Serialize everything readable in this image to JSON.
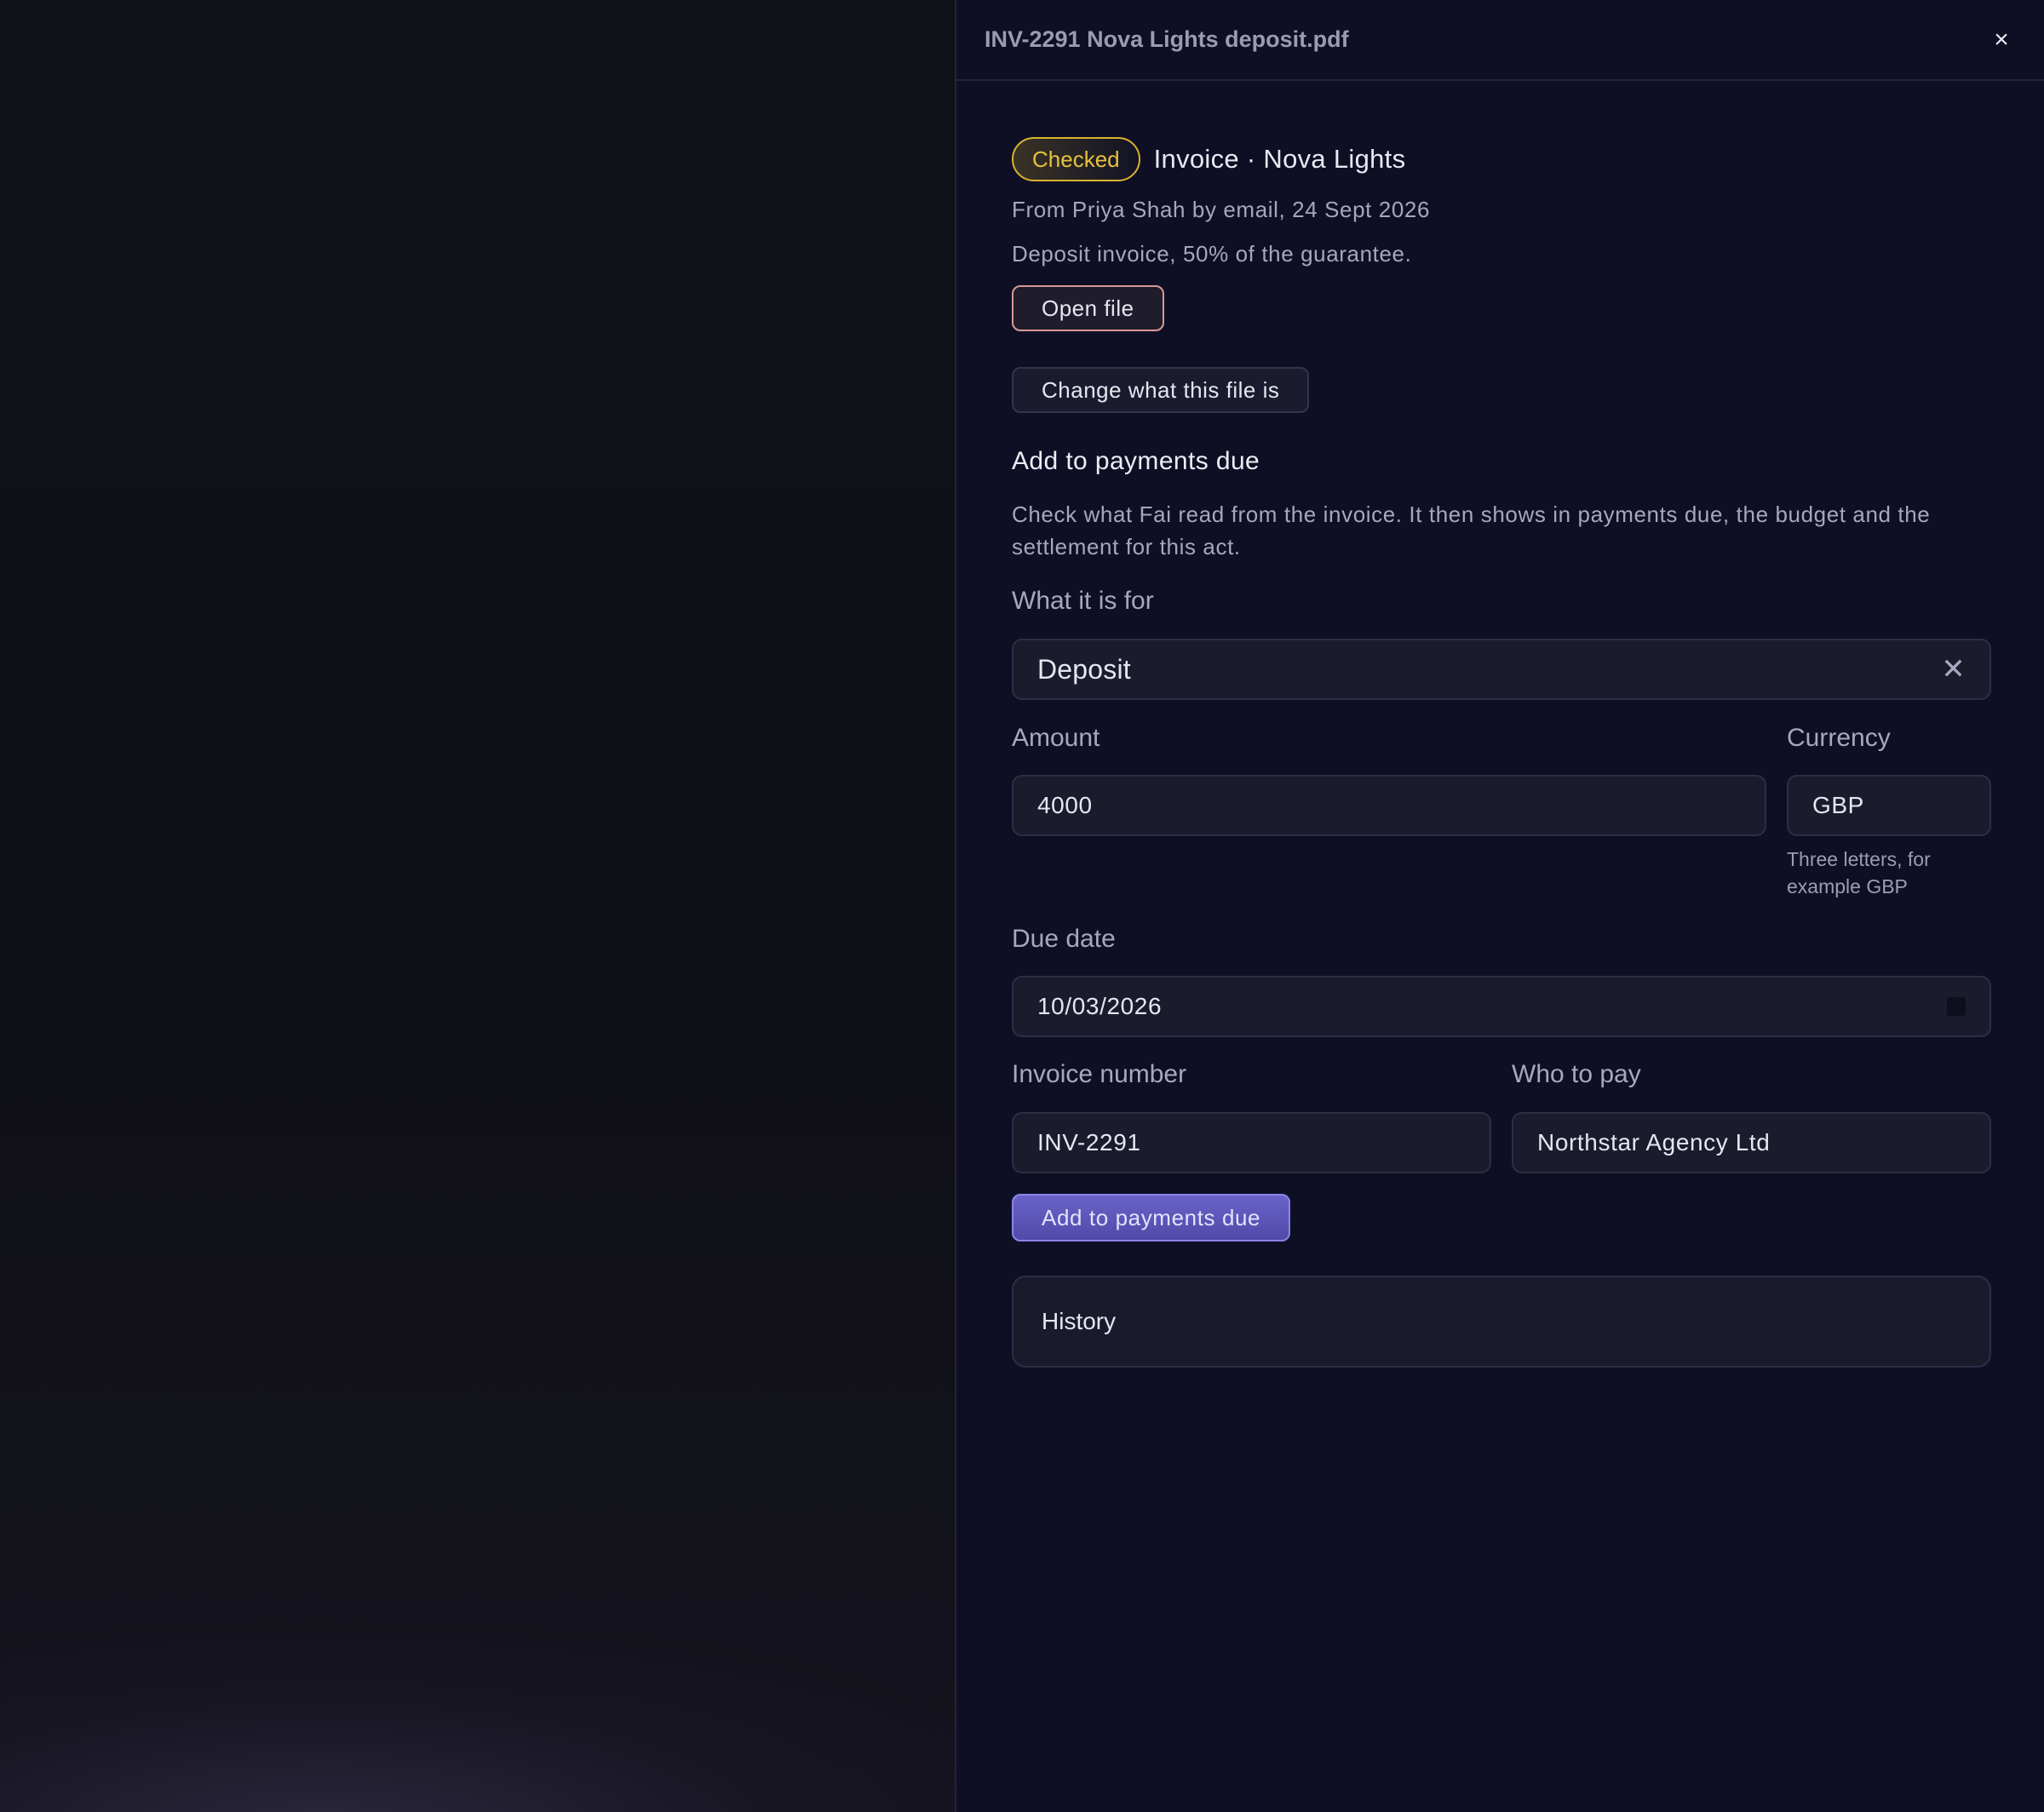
{
  "panel": {
    "title": "INV-2291 Nova Lights deposit.pdf",
    "close_label": "×"
  },
  "document": {
    "status_badge": "Checked",
    "kind": "Invoice · Nova Lights",
    "source": "From Priya Shah by email, 24 Sept 2026",
    "note": "Deposit invoice, 50% of the guarantee.",
    "open_file_label": "Open file",
    "change_type_label": "Change what this file is"
  },
  "payment_form": {
    "section_title": "Add to payments due",
    "help_text": "Check what Fai read from the invoice. It then shows in payments due, the budget and the settlement for this act.",
    "purpose_label": "What it is for",
    "purpose_value": "Deposit",
    "amount_label": "Amount",
    "amount_value": "4000",
    "currency_label": "Currency",
    "currency_value": "GBP",
    "currency_hint": "Three letters, for example GBP",
    "due_date_label": "Due date",
    "due_date_value": "10/03/2026",
    "invoice_number_label": "Invoice number",
    "invoice_number_value": "INV-2291",
    "payee_label": "Who to pay",
    "payee_value": "Northstar Agency Ltd",
    "submit_label": "Add to payments due"
  },
  "history": {
    "title": "History"
  },
  "colors": {
    "panel_bg": "#0e0f24",
    "badge_yellow": "#e6c23d",
    "primary_button": "#5d56b8",
    "open_button_border": "#d79a93"
  }
}
